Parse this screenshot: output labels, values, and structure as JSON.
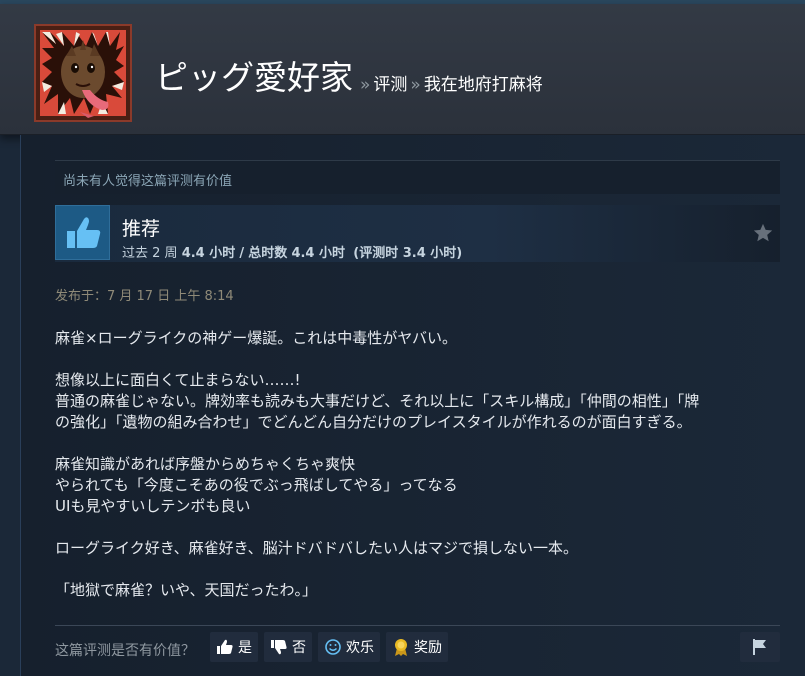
{
  "header": {
    "persona_name": "ピッグ愛好家",
    "breadcrumb": {
      "separator": "»",
      "section_label": "评测",
      "game_title": "我在地府打麻将"
    }
  },
  "review": {
    "helpful_status": "尚未有人觉得这篇评测有价值",
    "verdict": "推荐",
    "playtime": {
      "recent_prefix": "过去 2 周",
      "recent_hours": "4.4 小时",
      "divider": "/",
      "total_prefix": "总时数",
      "total_hours": "4.4 小时",
      "at_review": "(评测时 3.4 小时)"
    },
    "posted_date": "发布于：7 月 17 日 上午 8:14",
    "paragraphs": [
      [
        "麻雀×ローグライクの神ゲー爆誕。これは中毒性がヤバい。"
      ],
      [
        "想像以上に面白くて止まらない……!",
        "普通の麻雀じゃない。牌効率も読みも大事だけど、それ以上に「スキル構成」「仲間の相性」「牌",
        "の強化」「遺物の組み合わせ」でどんどん自分だけのプレイスタイルが作れるのが面白すぎる。"
      ],
      [
        "麻雀知識があれば序盤からめちゃくちゃ爽快",
        "やられても「今度こそあの役でぶっ飛ばしてやる」ってなる",
        "UIも見やすいしテンポも良い"
      ],
      [
        "ローグライク好き、麻雀好き、脳汁ドバドバしたい人はマジで損しない一本。"
      ],
      [
        "「地獄で麻雀？いや、天国だったわ。」"
      ]
    ]
  },
  "footer": {
    "question": "这篇评测是否有价值？",
    "yes_label": "是",
    "no_label": "否",
    "funny_label": "欢乐",
    "award_label": "奖励"
  },
  "icons": {
    "thumbs_up": "thumbs-up-icon",
    "star": "star-icon",
    "vote_up": "thumbs-up-small-icon",
    "vote_down": "thumbs-down-small-icon",
    "funny": "smiley-icon",
    "award": "award-ribbon-icon",
    "flag": "flag-icon"
  },
  "colors": {
    "background": "#1b2838",
    "header_bg": "#333a45",
    "recommend_icon_bg": "#1a4a6e",
    "recommend_icon": "#66c0f4",
    "award_gold": "#e8b923",
    "posted_text": "#8f8a78"
  }
}
